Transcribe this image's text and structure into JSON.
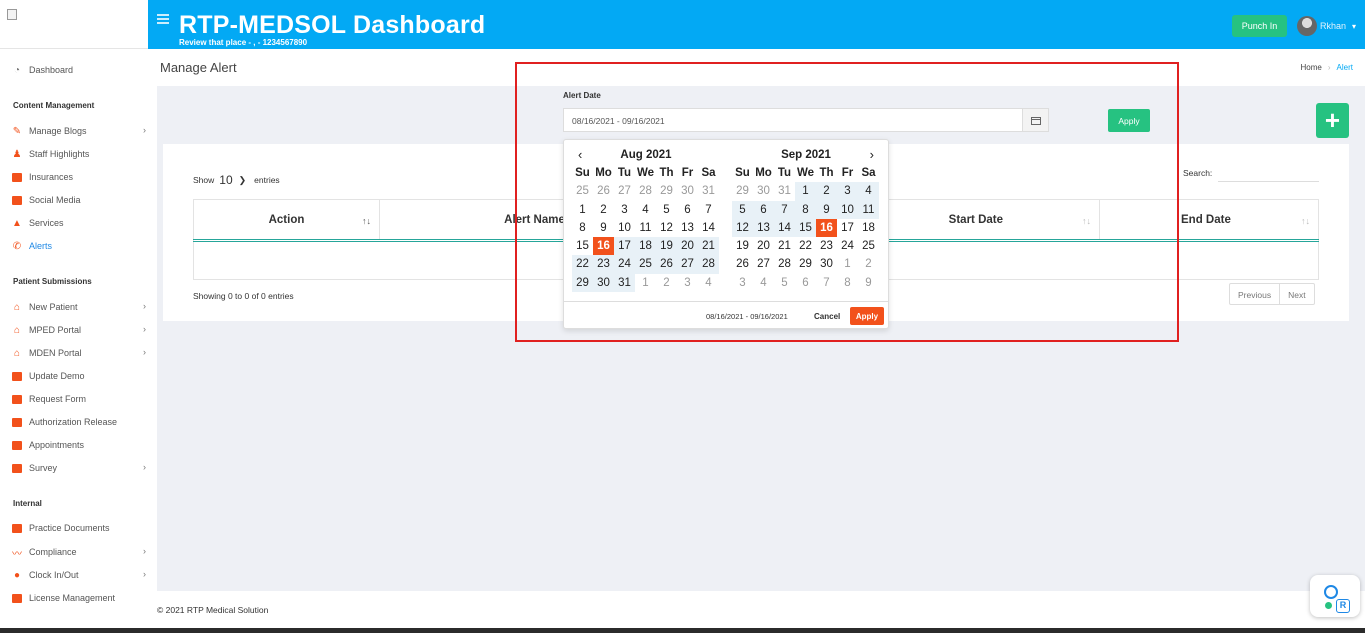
{
  "header": {
    "title": "RTP-MEDSOL Dashboard",
    "subtitle": "Review that place - , - 1234567890",
    "punch_label": "Punch In",
    "username": "Rkhan"
  },
  "sidebar": {
    "dashboard": "Dashboard",
    "sections": {
      "content": "Content Management",
      "patient": "Patient Submissions",
      "internal": "Internal"
    },
    "items": [
      "Manage Blogs",
      "Staff Highlights",
      "Insurances",
      "Social Media",
      "Services",
      "Alerts",
      "New Patient",
      "MPED Portal",
      "MDEN Portal",
      "Update Demo",
      "Request Form",
      "Authorization Release",
      "Appointments",
      "Survey",
      "Practice Documents",
      "Compliance",
      "Clock In/Out",
      "License Management"
    ]
  },
  "page": {
    "title": "Manage Alert",
    "breadcrumb": [
      "Home",
      "Alert"
    ]
  },
  "filter": {
    "label": "Alert Date",
    "value": "08/16/2021 - 09/16/2021",
    "apply_label": "Apply",
    "add_label": "+"
  },
  "table": {
    "show": "Show",
    "entries_value": "10",
    "entries": "entries",
    "search": "Search:",
    "columns": [
      "Action",
      "Alert Name",
      "Start Date",
      "End Date"
    ],
    "showing": "Showing 0 to 0 of 0 entries",
    "previous": "Previous",
    "next": "Next"
  },
  "picker": {
    "left_month": "Aug 2021",
    "right_month": "Sep 2021",
    "weekdays": [
      "Su",
      "Mo",
      "Tu",
      "We",
      "Th",
      "Fr",
      "Sa"
    ],
    "left_days": [
      [
        [
          "25",
          "off"
        ],
        [
          "26",
          "off"
        ],
        [
          "27",
          "off"
        ],
        [
          "28",
          "off"
        ],
        [
          "29",
          "off"
        ],
        [
          "30",
          "off"
        ],
        [
          "31",
          "off"
        ]
      ],
      [
        [
          "1",
          ""
        ],
        [
          "2",
          ""
        ],
        [
          "3",
          ""
        ],
        [
          "4",
          ""
        ],
        [
          "5",
          ""
        ],
        [
          "6",
          ""
        ],
        [
          "7",
          ""
        ]
      ],
      [
        [
          "8",
          ""
        ],
        [
          "9",
          ""
        ],
        [
          "10",
          ""
        ],
        [
          "11",
          ""
        ],
        [
          "12",
          ""
        ],
        [
          "13",
          ""
        ],
        [
          "14",
          ""
        ]
      ],
      [
        [
          "15",
          ""
        ],
        [
          "16",
          "sel"
        ],
        [
          "17",
          "range"
        ],
        [
          "18",
          "range"
        ],
        [
          "19",
          "range"
        ],
        [
          "20",
          "range"
        ],
        [
          "21",
          "range"
        ]
      ],
      [
        [
          "22",
          "range"
        ],
        [
          "23",
          "range"
        ],
        [
          "24",
          "range"
        ],
        [
          "25",
          "range"
        ],
        [
          "26",
          "range"
        ],
        [
          "27",
          "range"
        ],
        [
          "28",
          "range"
        ]
      ],
      [
        [
          "29",
          "range"
        ],
        [
          "30",
          "range"
        ],
        [
          "31",
          "range"
        ],
        [
          "1",
          "off"
        ],
        [
          "2",
          "off"
        ],
        [
          "3",
          "off"
        ],
        [
          "4",
          "off"
        ]
      ]
    ],
    "right_days": [
      [
        [
          "29",
          "off"
        ],
        [
          "30",
          "off"
        ],
        [
          "31",
          "off"
        ],
        [
          "1",
          "range"
        ],
        [
          "2",
          "range"
        ],
        [
          "3",
          "range"
        ],
        [
          "4",
          "range"
        ]
      ],
      [
        [
          "5",
          "range"
        ],
        [
          "6",
          "range"
        ],
        [
          "7",
          "range"
        ],
        [
          "8",
          "range"
        ],
        [
          "9",
          "range"
        ],
        [
          "10",
          "range"
        ],
        [
          "11",
          "range"
        ]
      ],
      [
        [
          "12",
          "range"
        ],
        [
          "13",
          "range"
        ],
        [
          "14",
          "range"
        ],
        [
          "15",
          "range"
        ],
        [
          "16",
          "sel"
        ],
        [
          "17",
          ""
        ],
        [
          "18",
          ""
        ]
      ],
      [
        [
          "19",
          ""
        ],
        [
          "20",
          ""
        ],
        [
          "21",
          ""
        ],
        [
          "22",
          ""
        ],
        [
          "23",
          ""
        ],
        [
          "24",
          ""
        ],
        [
          "25",
          ""
        ]
      ],
      [
        [
          "26",
          ""
        ],
        [
          "27",
          ""
        ],
        [
          "28",
          ""
        ],
        [
          "29",
          ""
        ],
        [
          "30",
          ""
        ],
        [
          "1",
          "off"
        ],
        [
          "2",
          "off"
        ]
      ],
      [
        [
          "3",
          "off"
        ],
        [
          "4",
          "off"
        ],
        [
          "5",
          "off"
        ],
        [
          "6",
          "off"
        ],
        [
          "7",
          "off"
        ],
        [
          "8",
          "off"
        ],
        [
          "9",
          "off"
        ]
      ]
    ],
    "range_text": "08/16/2021 - 09/16/2021",
    "cancel_label": "Cancel",
    "apply_label": "Apply"
  },
  "footer": {
    "copyright": "© 2021 RTP Medical Solution"
  },
  "colors": {
    "header": "#03a9f4",
    "accent_green": "#26c281",
    "accent_orange": "#f2511b",
    "highlight_red": "#e02020"
  }
}
